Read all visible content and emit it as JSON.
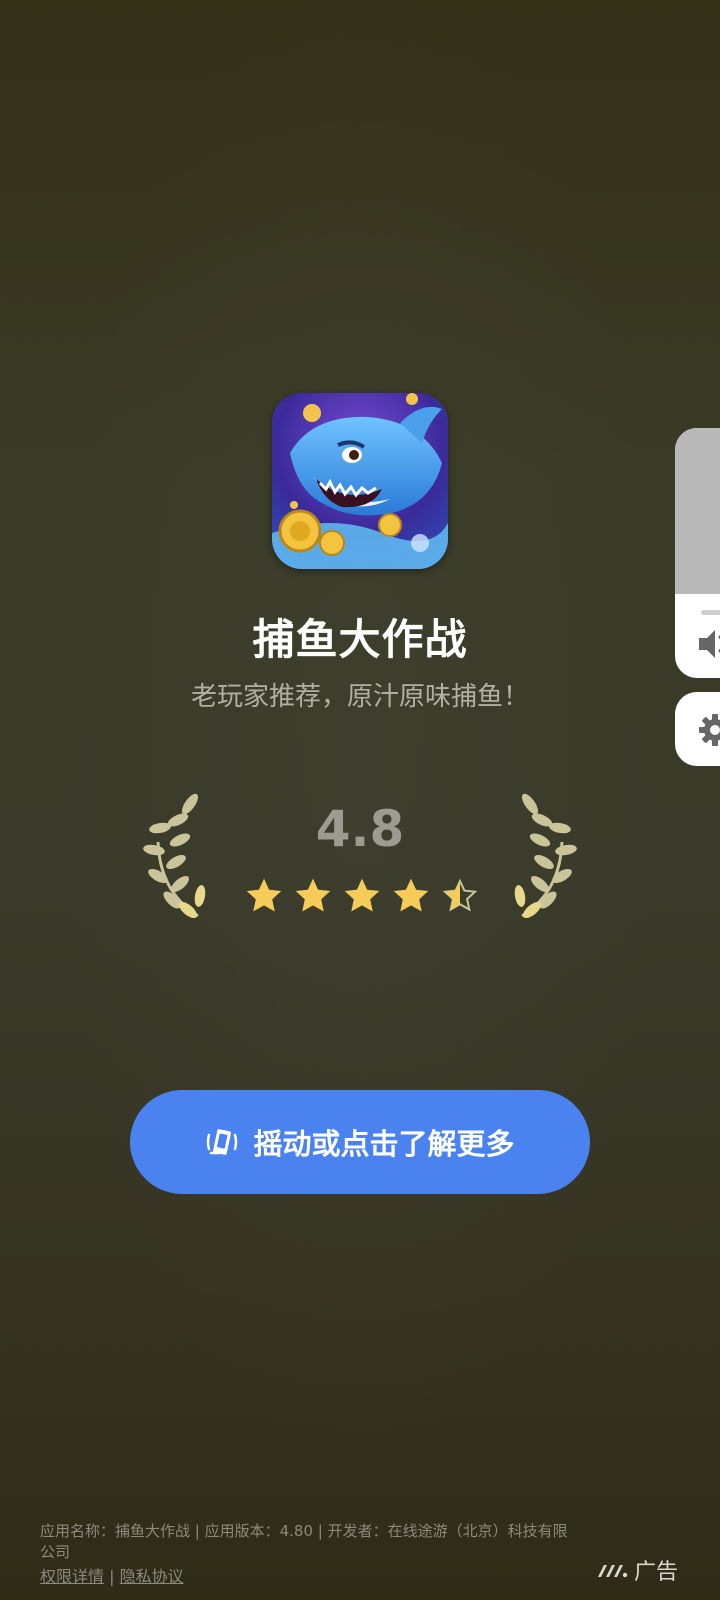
{
  "app": {
    "name": "捕鱼大作战",
    "slogan": "老玩家推荐，原汁原味捕鱼！"
  },
  "rating": {
    "value": "4.8",
    "stars_filled": 4.5,
    "stars_total": 5,
    "star_color": "#f5cc5a"
  },
  "cta": {
    "label": "摇动或点击了解更多",
    "color": "#4a82f0"
  },
  "footer": {
    "info": "应用名称：捕鱼大作战 | 应用版本：4.80 | 开发者：在线途游（北京）科技有限公司",
    "permissions_link": "权限详情",
    "separator": "|",
    "privacy_link": "隐私协议",
    "ad_label": "广告"
  },
  "controls": {
    "volume_icon": "volume-icon",
    "settings_icon": "gear-icon"
  }
}
